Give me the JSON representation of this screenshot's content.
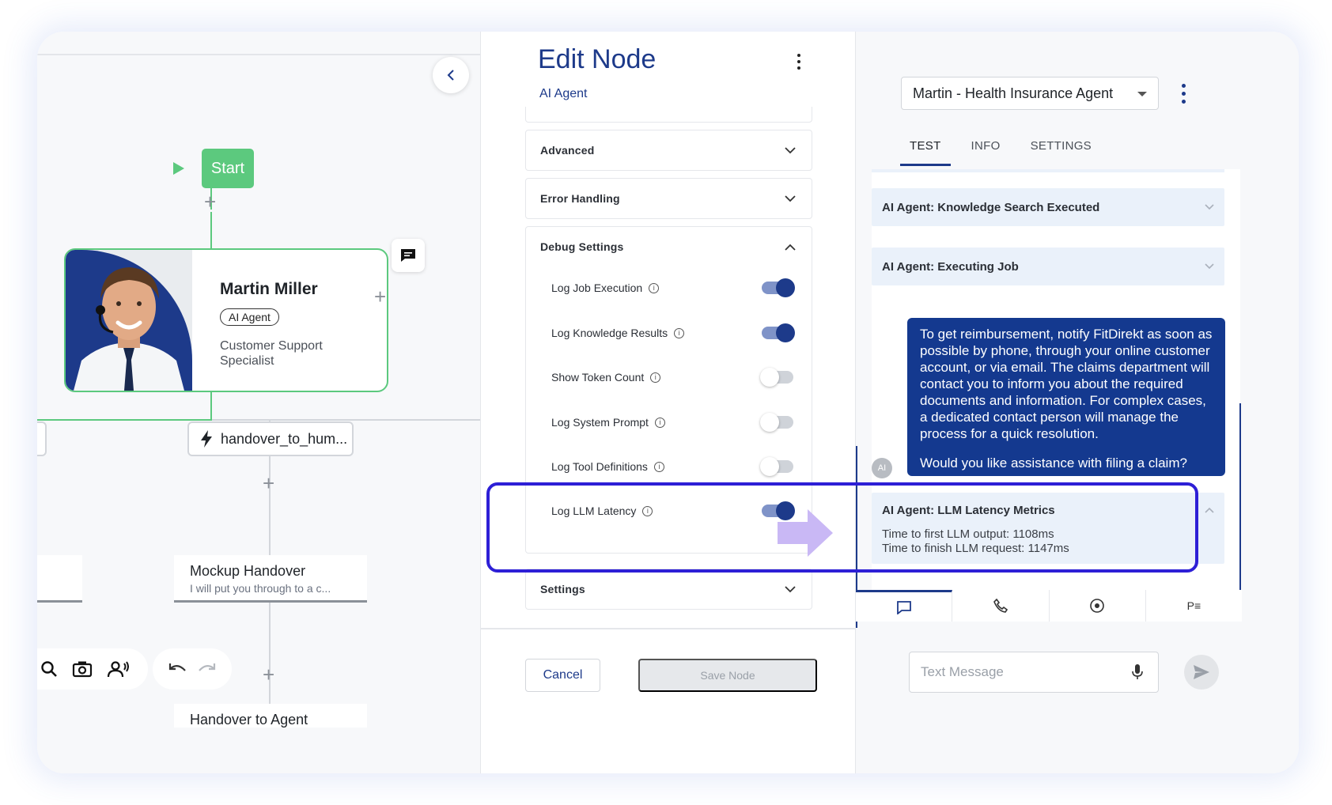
{
  "canvas": {
    "start_label": "Start",
    "agent": {
      "name": "Martin Miller",
      "badge": "AI Agent",
      "role": "Customer Support Specialist"
    },
    "handover_label": "handover_to_hum...",
    "mock_handover": {
      "title": "Mockup Handover",
      "subtitle": "I will put you through to a c..."
    },
    "partial_node_label": "Handover to Agent"
  },
  "edit_node": {
    "title": "Edit Node",
    "subtitle": "AI Agent",
    "sections": {
      "advanced": "Advanced",
      "error_handling": "Error Handling",
      "debug_settings": "Debug Settings",
      "settings": "Settings"
    },
    "toggles": [
      {
        "label": "Log Job Execution",
        "on": true
      },
      {
        "label": "Log Knowledge Results",
        "on": true
      },
      {
        "label": "Show Token Count",
        "on": false
      },
      {
        "label": "Log System Prompt",
        "on": false
      },
      {
        "label": "Log Tool Definitions",
        "on": false
      },
      {
        "label": "Log LLM Latency",
        "on": true
      }
    ],
    "cancel_label": "Cancel",
    "save_label": "Save Node"
  },
  "chat_panel": {
    "agent_select": "Martin - Health Insurance Agent",
    "tabs": [
      "TEST",
      "INFO",
      "SETTINGS"
    ],
    "active_tab": "TEST",
    "events": {
      "knowledge": "AI Agent: Knowledge Search Executed",
      "executing": "AI Agent: Executing Job",
      "latency": {
        "title": "AI Agent: LLM Latency Metrics",
        "first_output": "Time to first LLM output: 1108ms",
        "finish": "Time to finish LLM request: 1147ms"
      }
    },
    "bot_message": {
      "para1": "To get reimbursement, notify FitDirekt as soon as possible by phone, through your online customer account, or via email. The claims department will contact you to inform you about the required documents and information. For complex cases, a dedicated contact person will manage the process for a quick resolution.",
      "para2": "Would you like assistance with filing a claim?"
    },
    "avatar_label": "AI",
    "bottom_tab_last": "P≡",
    "input_placeholder": "Text Message"
  },
  "colors": {
    "brand": "#1d3a8a",
    "green": "#5cc97e",
    "highlight": "#2d1fd6",
    "arrow": "#c9b8f5"
  }
}
